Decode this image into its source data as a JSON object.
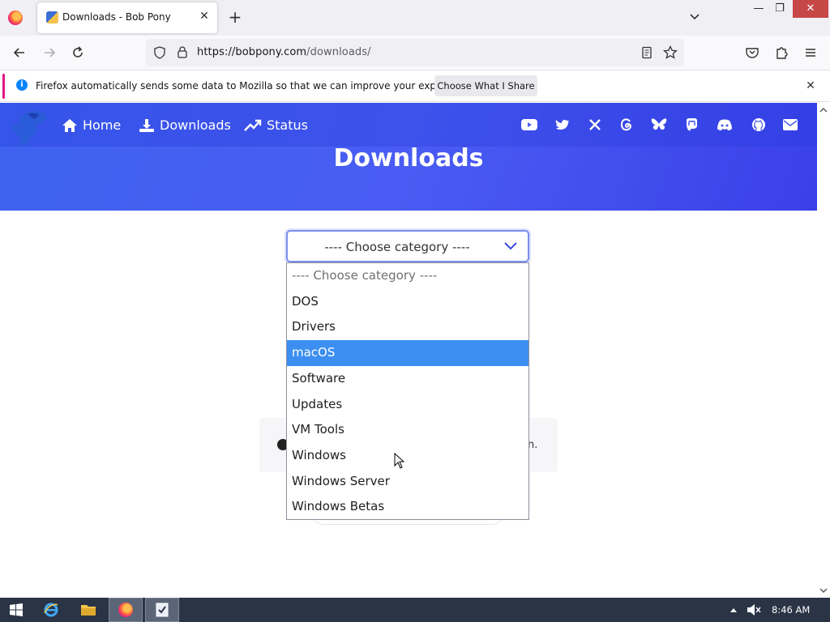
{
  "browser": {
    "tab_title": "Downloads - Bob Pony",
    "url_host": "https://bobpony.com",
    "url_path": "/downloads/",
    "window_controls": {
      "minimize": "—",
      "restore": "❐",
      "close": "✕"
    }
  },
  "notification": {
    "text": "Firefox automatically sends some data to Mozilla so that we can improve your experience.",
    "button_label": "Choose What I Share"
  },
  "site_nav": {
    "items": [
      {
        "label": "Home",
        "icon": "home-icon"
      },
      {
        "label": "Downloads",
        "icon": "download-icon"
      },
      {
        "label": "Status",
        "icon": "trending-up-icon"
      }
    ],
    "social_icons": [
      "youtube-icon",
      "twitter-icon",
      "x-icon",
      "threads-icon",
      "bluesky-icon",
      "mastodon-icon",
      "discord-icon",
      "github-icon",
      "email-icon"
    ],
    "accent_color": "#4a5cf3"
  },
  "page": {
    "title": "Downloads",
    "card_tail_text": "n."
  },
  "category_select": {
    "current_value": "---- Choose category ----",
    "highlight_color": "#3c8ff0",
    "options": [
      "---- Choose category ----",
      "DOS",
      "Drivers",
      "macOS",
      "Software",
      "Updates",
      "VM Tools",
      "Windows",
      "Windows Server",
      "Windows Betas"
    ],
    "highlighted_option": "macOS"
  },
  "taskbar": {
    "clock": "8:46 AM"
  }
}
